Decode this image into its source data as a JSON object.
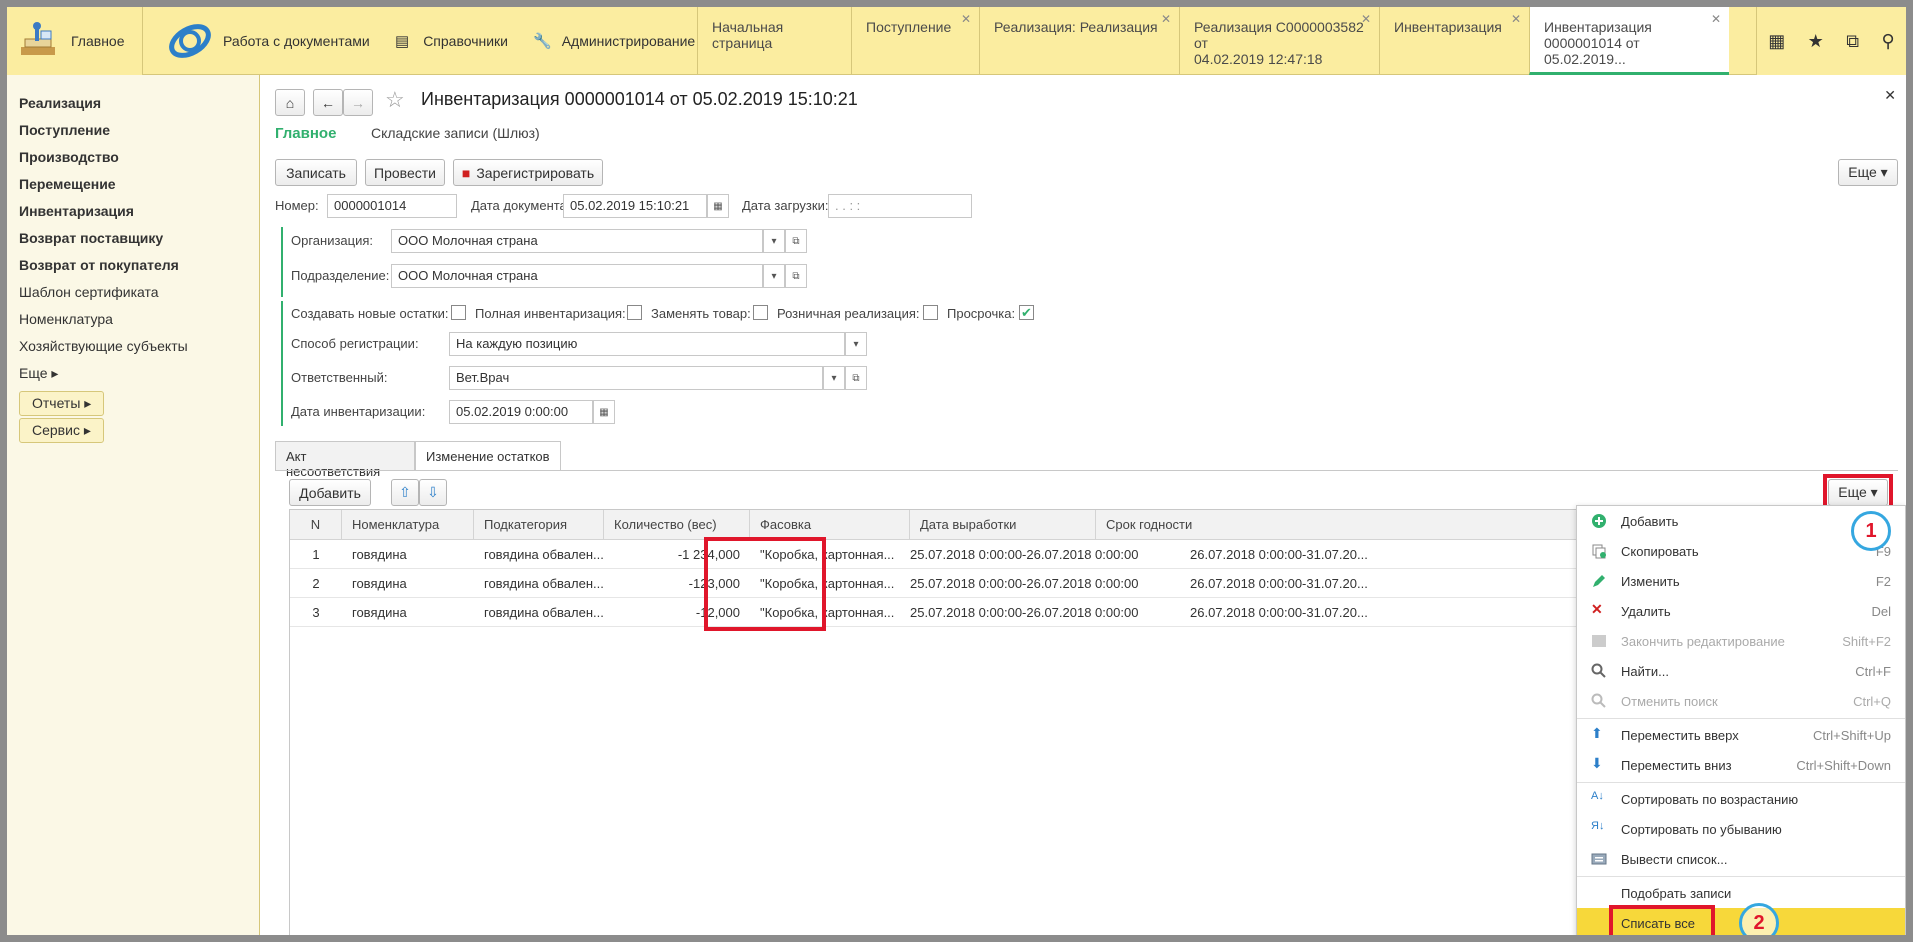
{
  "topbar": {
    "home_label": "Главное",
    "sections": [
      {
        "label": "Работа с документами"
      },
      {
        "label": "Справочники"
      },
      {
        "label": "Администрирование"
      }
    ],
    "tabs": [
      {
        "label": "Начальная страница",
        "closable": false
      },
      {
        "label": "Поступление",
        "closable": true
      },
      {
        "label": "Реализация: Реализация",
        "closable": true
      },
      {
        "label_line1": "Реализация С0000003582 от",
        "label_line2": "04.02.2019 12:47:18",
        "closable": true
      },
      {
        "label": "Инвентаризация",
        "closable": true
      },
      {
        "label_line1": "Инвентаризация",
        "label_line2": "0000001014 от 05.02.2019...",
        "closable": true,
        "active": true
      }
    ],
    "icons": [
      "apps-grid-icon",
      "star-icon",
      "history-icon",
      "search-icon"
    ]
  },
  "sidebar": {
    "items": [
      {
        "label": "Реализация",
        "bold": true
      },
      {
        "label": "Поступление",
        "bold": true
      },
      {
        "label": "Производство",
        "bold": true
      },
      {
        "label": "Перемещение",
        "bold": true
      },
      {
        "label": "Инвентаризация",
        "bold": true
      },
      {
        "label": "Возврат поставщику",
        "bold": true
      },
      {
        "label": "Возврат от покупателя",
        "bold": true
      },
      {
        "label": "Шаблон сертификата",
        "bold": false
      },
      {
        "label": "Номенклатура",
        "bold": false
      },
      {
        "label": "Хозяйствующие субъекты",
        "bold": false
      },
      {
        "label": "Еще ▸",
        "bold": false
      }
    ],
    "buttons": [
      {
        "label": "Отчеты ▸"
      },
      {
        "label": "Сервис ▸"
      }
    ]
  },
  "document": {
    "title": "Инвентаризация 0000001014 от 05.02.2019 15:10:21",
    "nav_tabs": [
      "Главное",
      "Складские записи (Шлюз)"
    ],
    "toolbar": {
      "save": "Записать",
      "post": "Провести",
      "register": "Зарегистрировать",
      "more": "Еще ▾"
    },
    "fields": {
      "number_label": "Номер:",
      "number": "0000001014",
      "date_label": "Дата документа:",
      "date": "05.02.2019 15:10:21",
      "load_date_label": "Дата загрузки:",
      "load_date": " .  .       :  :",
      "org_label": "Организация:",
      "org": "ООО Молочная страна",
      "dept_label": "Подразделение:",
      "dept": "ООО Молочная страна",
      "flags": [
        {
          "label": "Создавать новые остатки:",
          "checked": false
        },
        {
          "label": "Полная инвентаризация:",
          "checked": false
        },
        {
          "label": "Заменять товар:",
          "checked": false
        },
        {
          "label": "Розничная реализация:",
          "checked": false
        },
        {
          "label": "Просрочка:",
          "checked": true
        }
      ],
      "reg_method_label": "Способ регистрации:",
      "reg_method": "На каждую позицию",
      "responsible_label": "Ответственный:",
      "responsible": "Вет.Врач",
      "inv_date_label": "Дата инвентаризации:",
      "inv_date": "05.02.2019  0:00:00"
    },
    "sub_tabs": [
      "Акт несоответствия",
      "Изменение остатков"
    ],
    "grid_toolbar": {
      "add": "Добавить",
      "more": "Еще ▾"
    },
    "columns": [
      "N",
      "Номенклатура",
      "Подкатегория",
      "Количество (вес)",
      "Фасовка",
      "Дата выработки",
      "Срок годности"
    ],
    "rows": [
      {
        "n": "1",
        "item": "говядина",
        "sub": "говядина обвален...",
        "qty": "-1 234,000",
        "pack": "\"Коробка, картонная...",
        "prod": "25.07.2018 0:00:00-26.07.2018 0:00:00",
        "exp": "26.07.2018 0:00:00-31.07.20..."
      },
      {
        "n": "2",
        "item": "говядина",
        "sub": "говядина обвален...",
        "qty": "-123,000",
        "pack": "\"Коробка, картонная...",
        "prod": "25.07.2018 0:00:00-26.07.2018 0:00:00",
        "exp": "26.07.2018 0:00:00-31.07.20..."
      },
      {
        "n": "3",
        "item": "говядина",
        "sub": "говядина обвален...",
        "qty": "-12,000",
        "pack": "\"Коробка, картонная...",
        "prod": "25.07.2018 0:00:00-26.07.2018 0:00:00",
        "exp": "26.07.2018 0:00:00-31.07.20..."
      }
    ]
  },
  "context_menu": {
    "items": [
      {
        "label": "Добавить",
        "key": "",
        "icon": "add-icon"
      },
      {
        "label": "Скопировать",
        "key": "F9",
        "icon": "copy-icon"
      },
      {
        "label": "Изменить",
        "key": "F2",
        "icon": "edit-icon"
      },
      {
        "label": "Удалить",
        "key": "Del",
        "icon": "delete-icon"
      },
      {
        "label": "Закончить редактирование",
        "key": "Shift+F2",
        "icon": "end-edit-icon",
        "disabled": true
      },
      {
        "label": "Найти...",
        "key": "Ctrl+F",
        "icon": "find-icon"
      },
      {
        "label": "Отменить поиск",
        "key": "Ctrl+Q",
        "icon": "cancel-search-icon",
        "disabled": true
      },
      {
        "label": "Переместить вверх",
        "key": "Ctrl+Shift+Up",
        "icon": "move-up-icon"
      },
      {
        "label": "Переместить вниз",
        "key": "Ctrl+Shift+Down",
        "icon": "move-down-icon"
      },
      {
        "label": "Сортировать по возрастанию",
        "key": "",
        "icon": "sort-asc-icon"
      },
      {
        "label": "Сортировать по убыванию",
        "key": "",
        "icon": "sort-desc-icon"
      },
      {
        "label": "Вывести список...",
        "key": "",
        "icon": "print-list-icon"
      },
      {
        "label": "Подобрать записи",
        "key": "",
        "icon": ""
      },
      {
        "label": "Списать все",
        "key": "",
        "icon": "",
        "highlighted": true
      }
    ]
  },
  "annotations": {
    "marker1": "1",
    "marker2": "2"
  },
  "colors": {
    "accent_green": "#31b06e",
    "topbar_yellow": "#fbeda0",
    "highlight": "#f7d83a",
    "annotation_red": "#e0162b",
    "annotation_blue": "#35a7e0"
  }
}
